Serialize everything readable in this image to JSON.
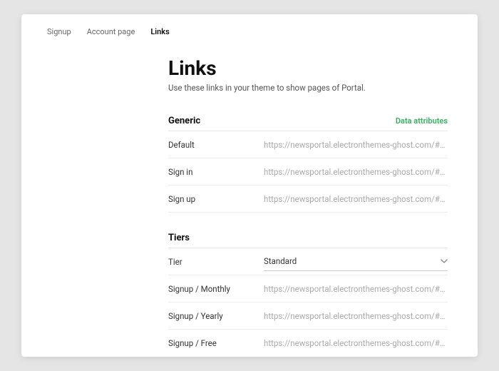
{
  "tabs": {
    "signup": "Signup",
    "account": "Account page",
    "links": "Links"
  },
  "page": {
    "title": "Links",
    "subtitle": "Use these links in your theme to show pages of Portal."
  },
  "generic": {
    "heading": "Generic",
    "dataAttr": "Data attributes",
    "rows": [
      {
        "label": "Default",
        "url": "https://newsportal.electronthemes-ghost.com/#/p"
      },
      {
        "label": "Sign in",
        "url": "https://newsportal.electronthemes-ghost.com/#/p"
      },
      {
        "label": "Sign up",
        "url": "https://newsportal.electronthemes-ghost.com/#/p"
      }
    ]
  },
  "tiers": {
    "heading": "Tiers",
    "tierLabel": "Tier",
    "tierSelected": "Standard",
    "rows": [
      {
        "label": "Signup / Monthly",
        "url": "https://newsportal.electronthemes-ghost.com/#/p"
      },
      {
        "label": "Signup / Yearly",
        "url": "https://newsportal.electronthemes-ghost.com/#/p"
      },
      {
        "label": "Signup / Free",
        "url": "https://newsportal.electronthemes-ghost.com/#/p"
      }
    ]
  }
}
